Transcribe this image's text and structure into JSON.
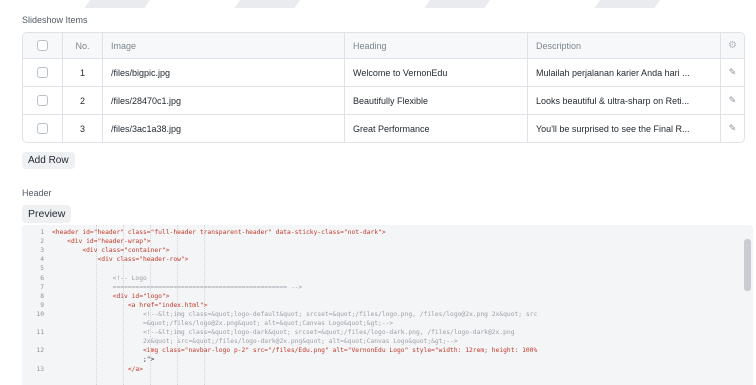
{
  "slideshow": {
    "label": "Slideshow Items",
    "columns": {
      "no": "No.",
      "image": "Image",
      "heading": "Heading",
      "description": "Description"
    },
    "rows": [
      {
        "no": "1",
        "image": "/files/bigpic.jpg",
        "heading": "Welcome to VernonEdu",
        "description": "Mulailah perjalanan karier Anda hari ..."
      },
      {
        "no": "2",
        "image": "/files/28470c1.jpg",
        "heading": "Beautifully Flexible",
        "description": "Looks beautiful & ultra-sharp on Reti..."
      },
      {
        "no": "3",
        "image": "/files/3ac1a38.jpg",
        "heading": "Great Performance",
        "description": "You'll be surprised to see the Final R..."
      }
    ],
    "add_row_label": "Add Row"
  },
  "header_section": {
    "label": "Header",
    "preview_label": "Preview"
  },
  "editor": {
    "lines": [
      {
        "n": "1",
        "code": "<header id=\"header\" class=\"full-header transparent-header\" data-sticky-class=\"not-dark\">"
      },
      {
        "n": "2",
        "code": "    <div id=\"header-wrap\">"
      },
      {
        "n": "3",
        "code": "        <div class=\"container\">"
      },
      {
        "n": "4",
        "code": "            <div class=\"header-row\">"
      },
      {
        "n": "5",
        "code": ""
      },
      {
        "n": "6",
        "code": "                <!-- Logo"
      },
      {
        "n": "7",
        "code": "                ============================================== -->"
      },
      {
        "n": "8",
        "code": "                <div id=\"logo\">"
      },
      {
        "n": "9",
        "code": "                    <a href=\"index.html\">"
      },
      {
        "n": "10",
        "code": "                        <!--&lt;img class=&quot;logo-default&quot; srcset=&quot;/files/logo.png, /files/logo@2x.png 2x&quot; src"
      },
      {
        "n": "",
        "code": "                        =&quot;/files/logo@2x.png&quot; alt=&quot;Canvas Logo&quot;&gt;-->"
      },
      {
        "n": "11",
        "code": "                        <!--&lt;img class=&quot;logo-dark&quot; srcset=&quot;/files/logo-dark.png, /files/logo-dark@2x.png"
      },
      {
        "n": "",
        "code": "                        2x&quot; src=&quot;/files/logo-dark@2x.png&quot; alt=&quot;Canvas Logo&quot;&gt;-->"
      },
      {
        "n": "12",
        "code": "                        <img class=\"navbar-logo p-2\" src=\"/files/Edu.png\" alt=\"VernonEdu Logo\" style=\"width: 12rem; height: 100%"
      },
      {
        "n": "",
        "code": "                        ;\">"
      },
      {
        "n": "13",
        "code": "                    </a>"
      }
    ]
  }
}
